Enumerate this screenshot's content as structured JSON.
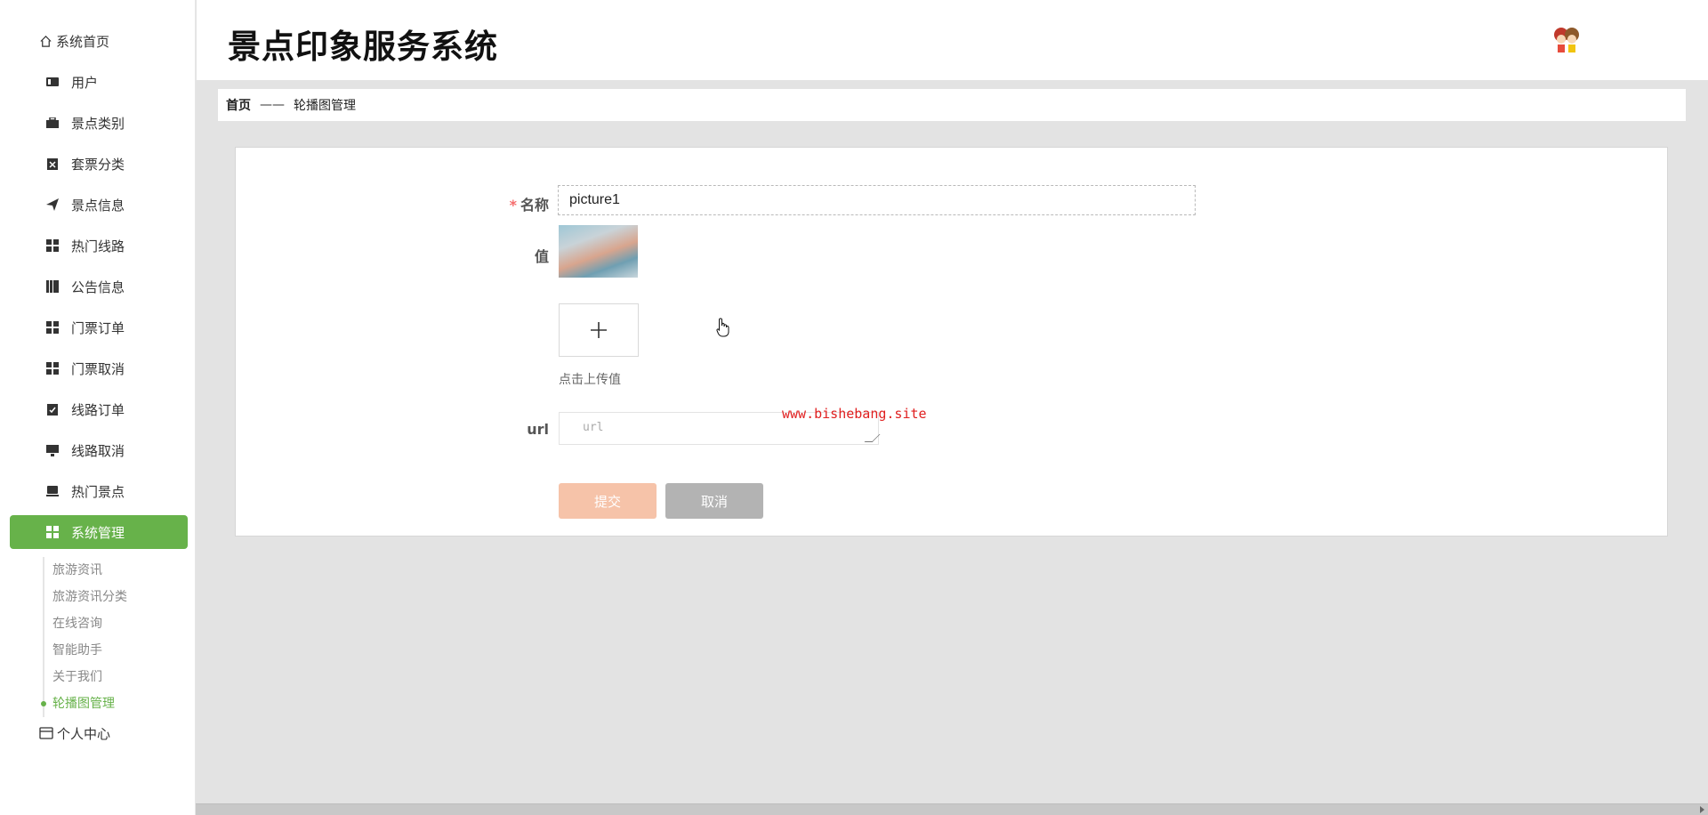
{
  "app": {
    "title": "景点印象服务系统"
  },
  "sidebar": {
    "home": "系统首页",
    "items": [
      {
        "label": "用户",
        "icon": "user-card-icon"
      },
      {
        "label": "景点类别",
        "icon": "briefcase-icon"
      },
      {
        "label": "套票分类",
        "icon": "clipboard-x-icon"
      },
      {
        "label": "景点信息",
        "icon": "send-icon"
      },
      {
        "label": "热门线路",
        "icon": "grid-icon"
      },
      {
        "label": "公告信息",
        "icon": "books-icon"
      },
      {
        "label": "门票订单",
        "icon": "grid-icon"
      },
      {
        "label": "门票取消",
        "icon": "grid-icon"
      },
      {
        "label": "线路订单",
        "icon": "clipboard-check-icon"
      },
      {
        "label": "线路取消",
        "icon": "monitor-icon"
      },
      {
        "label": "热门景点",
        "icon": "tablet-icon"
      },
      {
        "label": "系统管理",
        "icon": "grid-icon"
      }
    ],
    "sub_items": [
      "旅游资讯",
      "旅游资讯分类",
      "在线咨询",
      "智能助手",
      "关于我们",
      "轮播图管理"
    ],
    "personal": "个人中心",
    "active_color": "#67b24a"
  },
  "breadcrumb": {
    "home": "首页",
    "separator": "——",
    "current": "轮播图管理"
  },
  "form": {
    "name_label": "名称",
    "name_required": "*",
    "name_value": "picture1",
    "value_label": "值",
    "upload_plus": "+",
    "upload_tip": "点击上传值",
    "url_label": "url",
    "url_placeholder": "url",
    "submit_label": "提交",
    "cancel_label": "取消"
  },
  "watermark": "www.bishebang.site"
}
